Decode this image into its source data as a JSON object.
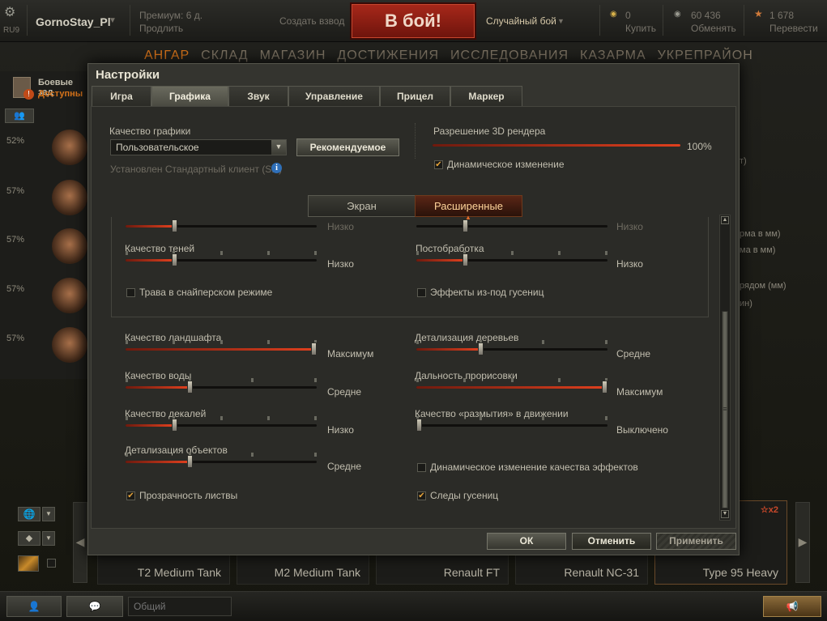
{
  "topbar": {
    "server": "RU9",
    "player_name": "GornoStay_Pl",
    "premium_text": "Премиум: 6 д.",
    "extend_text": "Продлить",
    "create_platoon": "Создать взвод",
    "battle_button": "В бой!",
    "battle_mode": "Случайный бой",
    "gold_amount": "0",
    "gold_action": "Купить",
    "xp_amount": "60 436",
    "xp_action": "Обменять",
    "free_xp_amount": "1 678",
    "free_xp_action": "Перевести"
  },
  "nav": [
    "АНГАР",
    "СКЛАД",
    "МАГАЗИН",
    "ДОСТИЖЕНИЯ",
    "ИССЛЕДОВАНИЯ",
    "КАЗАРМА",
    "УКРЕПРАЙОН"
  ],
  "missions": {
    "title": "Боевые зад",
    "subtitle": "Доступны"
  },
  "crew_percents": [
    "52%",
    "57%",
    "57%",
    "57%",
    "57%"
  ],
  "right_clipped": [
    "т)",
    "рма в мм)",
    "ма в мм)",
    "рядом (мм)",
    "ин)"
  ],
  "carousel": {
    "tanks": [
      "T2 Medium Tank",
      "M2 Medium Tank",
      "Renault FT",
      "Renault NC-31",
      "Type 95 Heavy"
    ],
    "multiplier": "x2"
  },
  "chat": {
    "placeholder": "Общий"
  },
  "settings": {
    "title": "Настройки",
    "tabs": [
      "Игра",
      "Графика",
      "Звук",
      "Управление",
      "Прицел",
      "Маркер"
    ],
    "active_tab": "Графика",
    "graphics_quality_label": "Качество графики",
    "graphics_quality_value": "Пользовательское",
    "recommended_button": "Рекомендуемое",
    "client_info": "Установлен Стандартный клиент (SD)",
    "render_resolution_label": "Разрешение 3D рендера",
    "render_resolution_value": "100%",
    "dynamic_change_label": "Динамическое изменение",
    "dynamic_change_checked": true,
    "sub_tabs": [
      "Экран",
      "Расширенные"
    ],
    "active_sub_tab": "Расширенные",
    "clipped_left_value": "Низко",
    "clipped_right_value": "Низко",
    "sliders": {
      "shadow_quality": {
        "label": "Качество теней",
        "value": "Низко",
        "level": 0.25
      },
      "post_processing": {
        "label": "Постобработка",
        "value": "Низко",
        "level": 0.25
      },
      "terrain_quality": {
        "label": "Качество ландшафта",
        "value": "Максимум",
        "level": 1.0
      },
      "tree_detail": {
        "label": "Детализация деревьев",
        "value": "Средне",
        "level": 0.33
      },
      "water_quality": {
        "label": "Качество воды",
        "value": "Средне",
        "level": 0.33
      },
      "draw_distance": {
        "label": "Дальность прорисовки",
        "value": "Максимум",
        "level": 1.0
      },
      "decal_quality": {
        "label": "Качество декалей",
        "value": "Низко",
        "level": 0.25
      },
      "motion_blur": {
        "label": "Качество «размытия» в движении",
        "value": "Выключено",
        "level": 0.0
      },
      "object_detail": {
        "label": "Детализация объектов",
        "value": "Средне",
        "level": 0.33
      }
    },
    "checkboxes": {
      "sniper_grass": {
        "label": "Трава в снайперском режиме",
        "checked": false
      },
      "track_effects": {
        "label": "Эффекты из-под гусениц",
        "checked": false
      },
      "dynamic_effects": {
        "label": "Динамическое изменение качества эффектов",
        "checked": false
      },
      "foliage_transparency": {
        "label": "Прозрачность листвы",
        "checked": true
      },
      "track_marks": {
        "label": "Следы гусениц",
        "checked": true
      }
    },
    "ok_button": "ОК",
    "cancel_button": "Отменить",
    "apply_button": "Применить"
  },
  "colors": {
    "accent_orange": "#d8741a",
    "battle_red": "#8c1c10",
    "slider_fill": "#e0401e",
    "checkbox_mark": "#e6a43a"
  }
}
